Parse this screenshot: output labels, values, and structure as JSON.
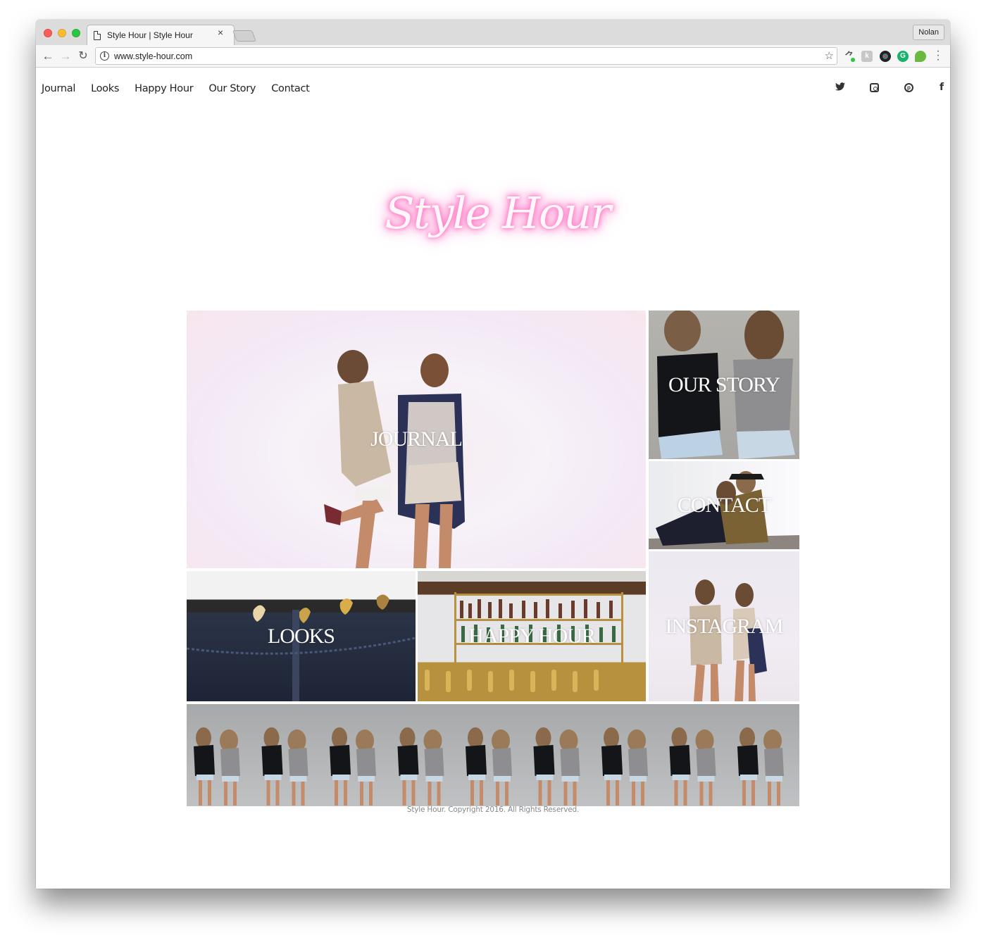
{
  "browser": {
    "tab_title": "Style Hour | Style Hour",
    "tab_close": "×",
    "profile_name": "Nolan",
    "url": "www.style-hour.com",
    "nav": {
      "back": "←",
      "forward": "→",
      "reload": "↻"
    },
    "star": "☆",
    "menu": "⋮",
    "extensions": [
      "tool-extension",
      "k-extension",
      "color-extension",
      "grammarly-extension",
      "evernote-extension"
    ]
  },
  "site": {
    "nav_items": [
      {
        "label": "Journal"
      },
      {
        "label": "Looks"
      },
      {
        "label": "Happy Hour"
      },
      {
        "label": "Our Story"
      },
      {
        "label": "Contact"
      }
    ],
    "social": {
      "twitter": "🐦",
      "facebook": "f",
      "pinterest": "p"
    },
    "logo_text": "Style Hour",
    "tiles": {
      "journal": "JOURNAL",
      "our_story": "OUR STORY",
      "contact": "CONTACT",
      "looks": "LOOKS",
      "happy_hour": "HAPPY HOUR",
      "instagram": "INSTAGRAM"
    },
    "footer": "Style Hour. Copyright 2016. All Rights Reserved."
  },
  "colors": {
    "neon_pink": "#ff5fb8",
    "nav_text": "#222222",
    "footer_text": "#888888"
  }
}
